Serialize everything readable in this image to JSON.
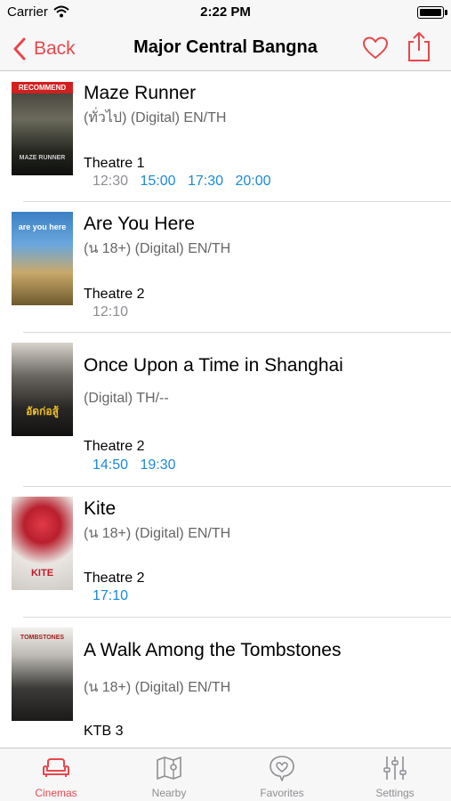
{
  "status_bar": {
    "carrier": "Carrier",
    "time": "2:22 PM"
  },
  "nav": {
    "back_label": "Back",
    "title": "Major Central Bangna"
  },
  "movies": [
    {
      "title": "Maze Runner",
      "details": "(ทั่วไป) (Digital) EN/TH",
      "theatre": "Theatre 1",
      "past_times": [
        "12:30"
      ],
      "times": [
        "15:00",
        "17:30",
        "20:00"
      ],
      "poster_badge": "RECOMMEND",
      "poster_text": "MAZE RUNNER"
    },
    {
      "title": "Are You Here",
      "details": "(น 18+) (Digital) EN/TH",
      "theatre": "Theatre 2",
      "past_times": [
        "12:10"
      ],
      "times": [],
      "poster_text": "are you here"
    },
    {
      "title": "Once Upon a Time in Shanghai",
      "details": "(Digital) TH/--",
      "theatre": "Theatre 2",
      "past_times": [],
      "times": [
        "14:50",
        "19:30"
      ],
      "poster_text": "อัดก่อสู้"
    },
    {
      "title": "Kite",
      "details": "(น 18+) (Digital) EN/TH",
      "theatre": "Theatre 2",
      "past_times": [],
      "times": [
        "17:10"
      ],
      "poster_text": "KITE"
    },
    {
      "title": "A Walk Among the Tombstones",
      "details": "(น 18+) (Digital) EN/TH",
      "theatre": "KTB 3",
      "past_times": [],
      "times": [],
      "poster_text": "TOMBSTONES"
    }
  ],
  "tabs": [
    {
      "label": "Cinemas",
      "icon": "sofa-icon",
      "active": true
    },
    {
      "label": "Nearby",
      "icon": "map-icon",
      "active": false
    },
    {
      "label": "Favorites",
      "icon": "heart-bubble-icon",
      "active": false
    },
    {
      "label": "Settings",
      "icon": "sliders-icon",
      "active": false
    }
  ],
  "colors": {
    "accent": "#e8474c",
    "link_time": "#1a8adb",
    "past_time": "#8e8e93"
  }
}
